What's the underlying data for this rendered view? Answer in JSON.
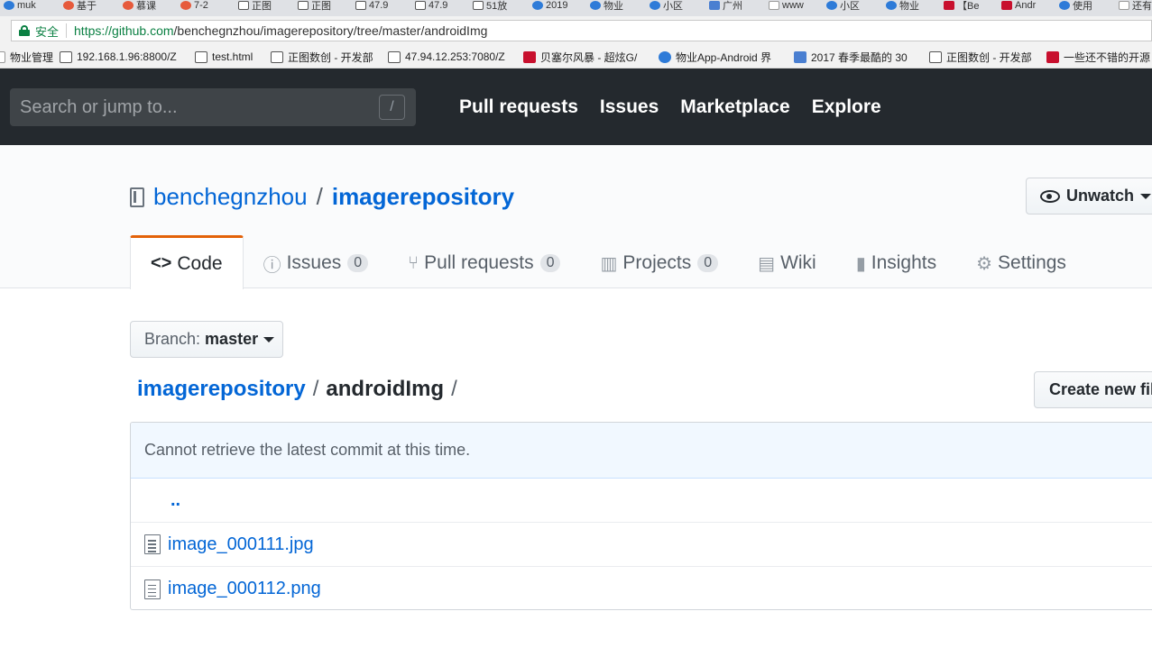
{
  "browser": {
    "tabs": [
      {
        "label": "muk",
        "icon": "globe-icon"
      },
      {
        "label": "基于",
        "icon": "flame-icon"
      },
      {
        "label": "慕课",
        "icon": "flame-icon"
      },
      {
        "label": "7-2",
        "icon": "flame-icon"
      },
      {
        "label": "正图",
        "icon": "image-icon"
      },
      {
        "label": "正图",
        "icon": "image-icon"
      },
      {
        "label": "47.9",
        "icon": "image-icon"
      },
      {
        "label": "47.9",
        "icon": "image-icon"
      },
      {
        "label": "51放",
        "icon": "image-icon"
      },
      {
        "label": "2019",
        "icon": "globe-icon"
      },
      {
        "label": "物业",
        "icon": "globe-icon"
      },
      {
        "label": "小区",
        "icon": "globe-icon"
      },
      {
        "label": "广州",
        "icon": "refresh-icon"
      },
      {
        "label": "www",
        "icon": "page-icon"
      },
      {
        "label": "小区",
        "icon": "globe-icon"
      },
      {
        "label": "物业",
        "icon": "globe-icon"
      },
      {
        "label": "【Be",
        "icon": "csdn-icon"
      },
      {
        "label": "Andr",
        "icon": "csdn-icon"
      },
      {
        "label": "使用",
        "icon": "globe-icon"
      },
      {
        "label": "还有",
        "icon": "page-icon"
      }
    ],
    "secure_label": "安全",
    "url_host": "https://github.com",
    "url_path": "/benchegnzhou/imagerepository/tree/master/androidImg",
    "bookmarks": [
      {
        "label": "物业管理",
        "icon": "folder-icon"
      },
      {
        "label": "192.168.1.96:8800/Z",
        "icon": "image-icon"
      },
      {
        "label": "test.html",
        "icon": "image-icon"
      },
      {
        "label": "正图数创 - 开发部",
        "icon": "image-icon"
      },
      {
        "label": "47.94.12.253:7080/Z",
        "icon": "image-icon"
      },
      {
        "label": "贝塞尔风暴 - 超炫G/",
        "icon": "csdn-icon"
      },
      {
        "label": "物业App-Android 界",
        "icon": "globe-icon"
      },
      {
        "label": "2017 春季最酷的 30",
        "icon": "refresh-icon"
      },
      {
        "label": "正图数创 - 开发部",
        "icon": "image-icon"
      },
      {
        "label": "一些还不错的开源",
        "icon": "csdn-icon"
      }
    ]
  },
  "header": {
    "search_placeholder": "Search or jump to...",
    "search_shortcut": "/",
    "nav": [
      "Pull requests",
      "Issues",
      "Marketplace",
      "Explore"
    ]
  },
  "repo": {
    "owner": "benchegnzhou",
    "separator": "/",
    "name": "imagerepository",
    "unwatch_label": "Unwatch",
    "tabs": [
      {
        "label": "Code",
        "icon": "<>",
        "counter": null
      },
      {
        "label": "Issues",
        "icon": "ⓘ",
        "counter": "0"
      },
      {
        "label": "Pull requests",
        "icon": "⑂",
        "counter": "0"
      },
      {
        "label": "Projects",
        "icon": "▥",
        "counter": "0"
      },
      {
        "label": "Wiki",
        "icon": "▤",
        "counter": null
      },
      {
        "label": "Insights",
        "icon": "▮",
        "counter": null
      },
      {
        "label": "Settings",
        "icon": "⚙",
        "counter": null
      }
    ]
  },
  "content": {
    "branch_prefix": "Branch:",
    "branch_name": "master",
    "path_root": "imagerepository",
    "path_dir": "androidImg",
    "path_sep": "/",
    "create_file_label": "Create new file",
    "commit_message": "Cannot retrieve the latest commit at this time.",
    "up_link": "..",
    "files": [
      "image_000111.jpg",
      "image_000112.png"
    ]
  },
  "colors": {
    "header_bg": "#24292e",
    "link": "#0366d6",
    "tab_accent": "#e36209",
    "secure_green": "#0b8043"
  }
}
